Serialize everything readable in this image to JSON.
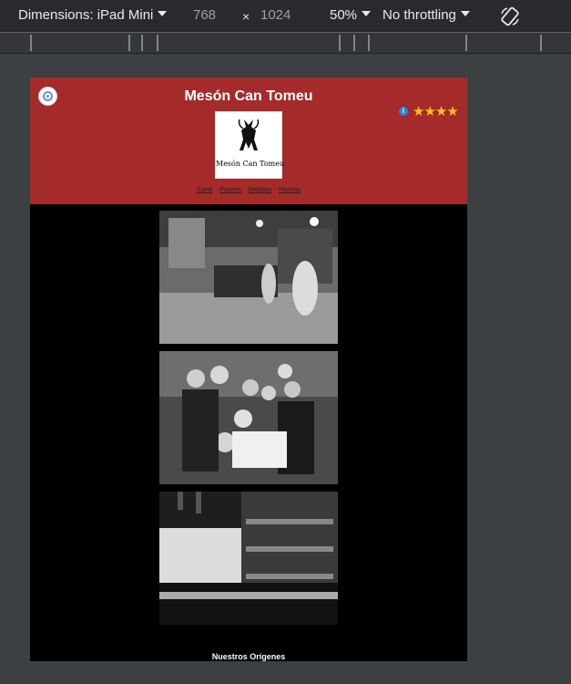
{
  "toolbar": {
    "dimensions_label": "Dimensions: iPad Mini",
    "width": "768",
    "times": "×",
    "height": "1024",
    "zoom": "50%",
    "throttling": "No throttling"
  },
  "site": {
    "title": "Mesón Can Tomeu",
    "logo_text": "Mesón Can Tomeu",
    "rating_stars": "★★★★",
    "rating_value": 4,
    "info_icon": "i",
    "nav": [
      "Carta",
      "Postres",
      "Bebidas",
      "Historia"
    ],
    "photos": [
      "bar-interior-photo",
      "staff-group-photo",
      "bar-shelves-photo"
    ],
    "caption": "Nuestros Orígenes"
  },
  "colors": {
    "header": "#a52a2a",
    "stars": "#f6c21c",
    "page_bg": "#000000"
  }
}
